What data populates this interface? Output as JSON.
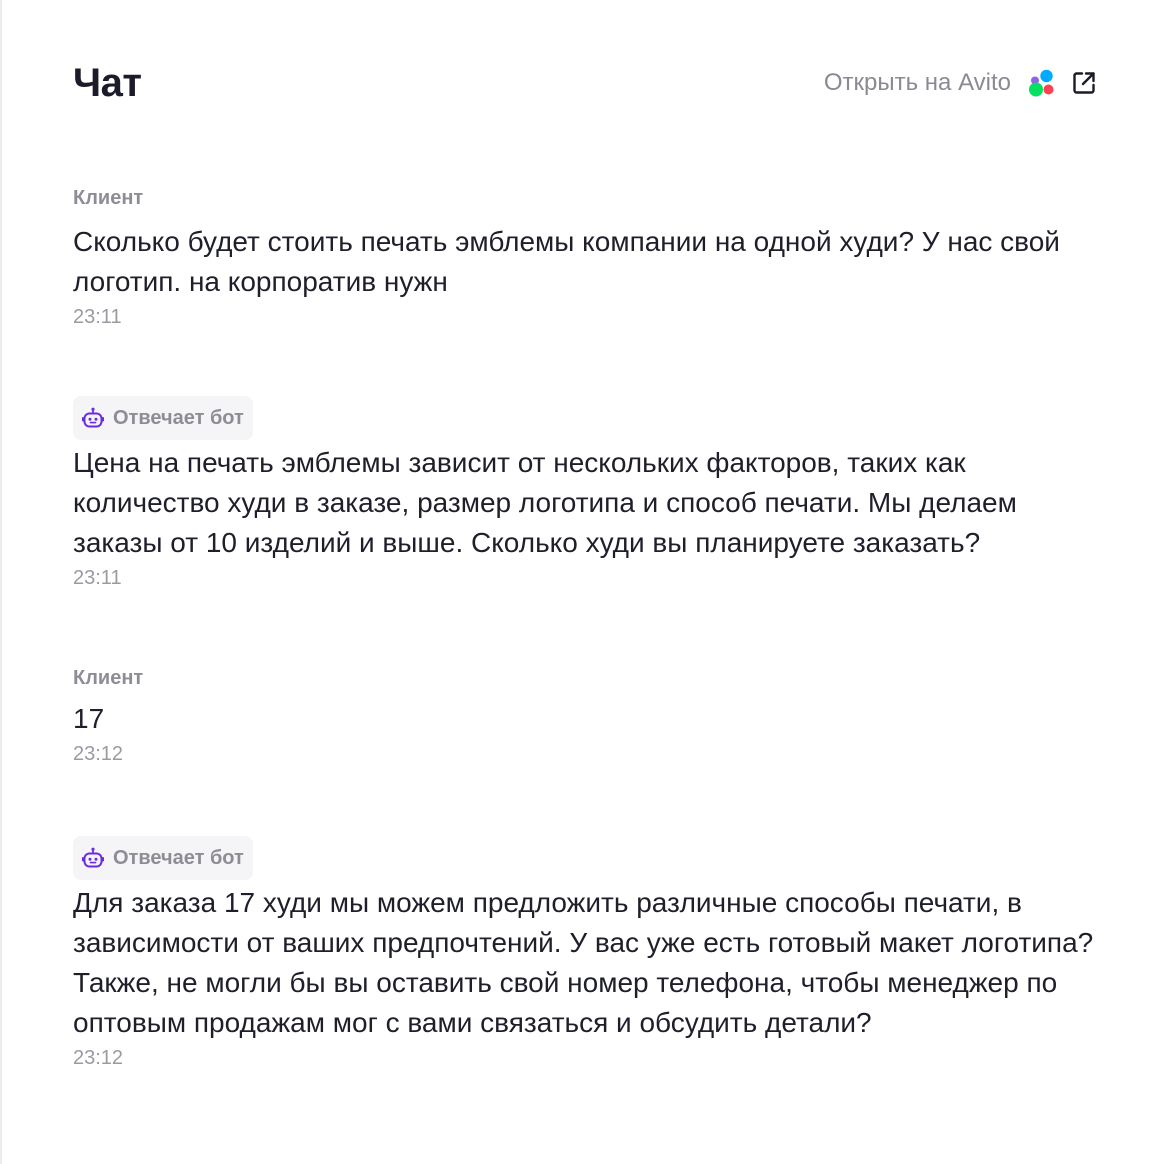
{
  "header": {
    "title": "Чат",
    "open_link_label": "Открыть на Avito",
    "avito_logo_icon": "avito-logo",
    "external_icon": "external-link-icon"
  },
  "colors": {
    "bot_icon": "#6a2ce0",
    "avito_blue": "#00aaff",
    "avito_green": "#04e061",
    "avito_red": "#ff4053",
    "avito_purple": "#965eeb"
  },
  "messages": [
    {
      "sender": "Клиент",
      "text": "Сколько будет стоить печать эмблемы компании на одной худи? У нас свой логотип. на корпоратив нужн",
      "time": "23:11"
    },
    {
      "sender": "Отвечает бот",
      "icon": "bot-icon",
      "text": "Цена на печать эмблемы зависит от нескольких факторов, таких как количество худи в заказе, размер логотипа и способ печати. Мы делаем заказы от 10 изделий и выше. Сколько худи вы планируете заказать?",
      "time": "23:11"
    },
    {
      "sender": "Клиент",
      "text": "17",
      "time": "23:12"
    },
    {
      "sender": "Отвечает бот",
      "icon": "bot-icon",
      "text": "Для заказа 17 худи мы можем предложить различные способы печати, в зависимости от ваших предпочтений. У вас уже есть готовый макет логотипа? Также, не могли бы вы оставить свой номер телефона, чтобы менеджер по оптовым продажам мог с вами связаться и обсудить детали?",
      "time": "23:12"
    }
  ]
}
